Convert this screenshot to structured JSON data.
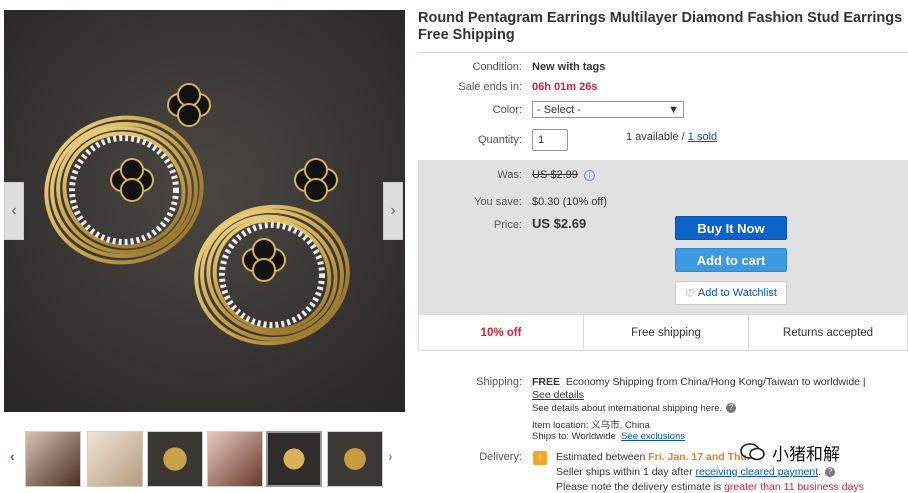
{
  "product": {
    "title": "Round Pentagram Earrings Multilayer Diamond Fashion Stud Earrings Free Shipping"
  },
  "details": {
    "condition_label": "Condition:",
    "condition_value": "New with tags",
    "sale_label": "Sale ends in:",
    "sale_value": "06h 01m 26s",
    "color_label": "Color:",
    "color_value": "- Select -",
    "quantity_label": "Quantity:",
    "quantity_value": "1",
    "available_text": "1 available /",
    "sold_link": "1 sold"
  },
  "pricing": {
    "was_label": "Was:",
    "was_value": "US $2.99",
    "save_label": "You save:",
    "save_value": "$0.30 (10% off)",
    "price_label": "Price:",
    "price_value": "US $2.69",
    "info_icon": "i"
  },
  "buttons": {
    "buy_now": "Buy It Now",
    "add_to_cart": "Add to cart",
    "watchlist_icon": "♡",
    "watchlist": "Add to Watchlist"
  },
  "highlights": [
    "10% off",
    "Free shipping",
    "Returns accepted"
  ],
  "shipping": {
    "label": "Shipping:",
    "free": "FREE",
    "method": "Economy Shipping from China/Hong Kong/Taiwan to worldwide |",
    "see_details": "See details",
    "international": "See details about international shipping here.",
    "location_label": "Item location:",
    "location_value": "义乌市, China",
    "ships_to_label": "Ships to:",
    "ships_to_value": "Worldwide",
    "see_exclusions": "See exclusions"
  },
  "delivery": {
    "label": "Delivery:",
    "badge": "!",
    "estimated_prefix": "Estimated between",
    "estimated_dates": "Fri. Jan. 17 and Thu. F",
    "seller_ships": "Seller ships within 1 day after",
    "receiving_link": "receiving cleared payment",
    "note_prefix": "Please note the delivery estimate is",
    "note_emph": "greater than 11 business days"
  },
  "gallery": {
    "prev_icon": "‹",
    "next_icon": "›",
    "thumb_prev": "‹",
    "thumb_next": "›"
  },
  "watermark": {
    "text": "小猪和解"
  },
  "help_icon": "?",
  "colors": {
    "price_red": "#dd1e31",
    "link_blue": "#0654ba",
    "buy_button": "#0b63c9",
    "cart_button": "#3c9ae0",
    "panel_gray": "#e1e1e1"
  }
}
